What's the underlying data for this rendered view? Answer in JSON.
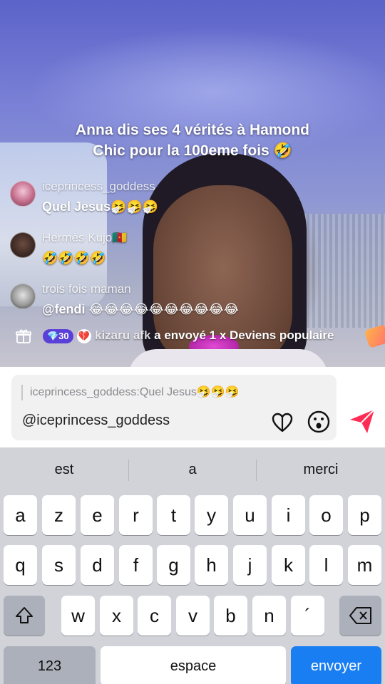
{
  "live": {
    "caption": "Anna dis ses 4 vérités à Hamond Chic pour la 100eme fois 🤣",
    "comments": [
      {
        "username": "iceprincess_goddess",
        "text": "Quel Jesus🤧🤧🤧"
      },
      {
        "username": "Hermès Kujo🇨🇲",
        "text": "🤣🤣🤣🤣"
      },
      {
        "username": "trois fois maman",
        "text": "@fendi 😂😂😂😂😂😂😂😂😂😂"
      }
    ],
    "gift_event": {
      "level_badge": "💎30",
      "heart_badge": "💔",
      "username": "kizaru afk",
      "text": " a envoyé 1 x Deviens populaire"
    }
  },
  "composer": {
    "quote": "iceprincess_goddess:Quel Jesus🤧🤧🤧",
    "value": "@iceprincess_goddess"
  },
  "keyboard": {
    "suggestions": [
      "est",
      "a",
      "merci"
    ],
    "row1": [
      "a",
      "z",
      "e",
      "r",
      "t",
      "y",
      "u",
      "i",
      "o",
      "p"
    ],
    "row2": [
      "q",
      "s",
      "d",
      "f",
      "g",
      "h",
      "j",
      "k",
      "l",
      "m"
    ],
    "row3": [
      "w",
      "x",
      "c",
      "v",
      "b",
      "n",
      "´"
    ],
    "numbers_key": "123",
    "space_key": "espace",
    "send_key": "envoyer"
  },
  "colors": {
    "send_accent": "#fe2c55",
    "send_key_blue": "#1a7ef3"
  }
}
